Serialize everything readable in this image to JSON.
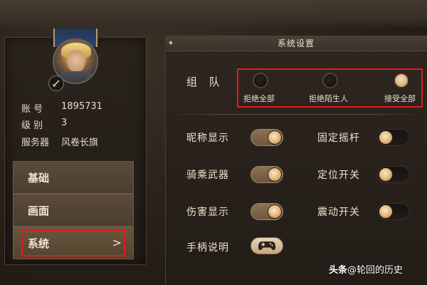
{
  "player": {
    "account_label": "账  号",
    "account_value": "1895731",
    "level_label": "级  别",
    "level_value": "3",
    "server_label": "服务器",
    "server_value": "风卷长旗"
  },
  "tabs": [
    {
      "label": "基础"
    },
    {
      "label": "画面"
    },
    {
      "label": "系统",
      "selected": true,
      "chevron": ">"
    }
  ],
  "settings": {
    "title": "系统设置",
    "team": {
      "label": "组 队",
      "options": [
        {
          "label": "拒绝全部",
          "selected": false
        },
        {
          "label": "拒绝陌生人",
          "selected": false
        },
        {
          "label": "接受全部",
          "selected": true
        }
      ]
    },
    "toggles": [
      {
        "label": "昵称显示",
        "on": true
      },
      {
        "label": "固定摇杆",
        "on": false
      },
      {
        "label": "骑乘武器",
        "on": true
      },
      {
        "label": "定位开关",
        "on": false
      },
      {
        "label": "伤害显示",
        "on": true
      },
      {
        "label": "震动开关",
        "on": false
      }
    ],
    "gamepad": {
      "label": "手柄说明"
    }
  },
  "watermark": {
    "brand": "头条",
    "handle": "@轮回的历史"
  },
  "colors": {
    "highlight": "#e01c1c",
    "toggle_on": "#8c7356",
    "knob": "#e0b47a"
  }
}
